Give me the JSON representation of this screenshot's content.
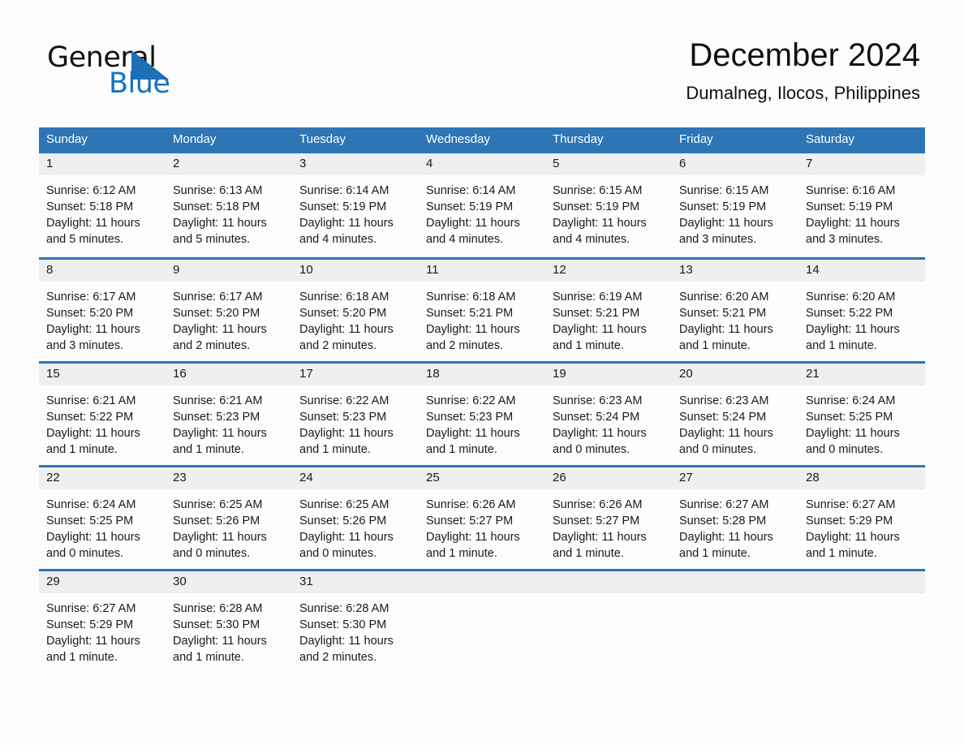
{
  "brand": {
    "name_part1": "General",
    "name_part2": "Blue",
    "logo_icon": "triangle-logo-icon",
    "accent_color": "#1673c4"
  },
  "header": {
    "title": "December 2024",
    "location": "Dumalneg, Ilocos, Philippines"
  },
  "theme": {
    "header_blue": "#2e75b6",
    "row_divider_blue": "#2e75b6",
    "daynum_band_gray": "#efefef",
    "page_background": "#fdfdfd",
    "text_color": "#1a1a1a"
  },
  "weekday_headers": [
    "Sunday",
    "Monday",
    "Tuesday",
    "Wednesday",
    "Thursday",
    "Friday",
    "Saturday"
  ],
  "weeks": [
    [
      {
        "day": "1",
        "sunrise": "Sunrise: 6:12 AM",
        "sunset": "Sunset: 5:18 PM",
        "daylight_line1": "Daylight: 11 hours",
        "daylight_line2": "and 5 minutes."
      },
      {
        "day": "2",
        "sunrise": "Sunrise: 6:13 AM",
        "sunset": "Sunset: 5:18 PM",
        "daylight_line1": "Daylight: 11 hours",
        "daylight_line2": "and 5 minutes."
      },
      {
        "day": "3",
        "sunrise": "Sunrise: 6:14 AM",
        "sunset": "Sunset: 5:19 PM",
        "daylight_line1": "Daylight: 11 hours",
        "daylight_line2": "and 4 minutes."
      },
      {
        "day": "4",
        "sunrise": "Sunrise: 6:14 AM",
        "sunset": "Sunset: 5:19 PM",
        "daylight_line1": "Daylight: 11 hours",
        "daylight_line2": "and 4 minutes."
      },
      {
        "day": "5",
        "sunrise": "Sunrise: 6:15 AM",
        "sunset": "Sunset: 5:19 PM",
        "daylight_line1": "Daylight: 11 hours",
        "daylight_line2": "and 4 minutes."
      },
      {
        "day": "6",
        "sunrise": "Sunrise: 6:15 AM",
        "sunset": "Sunset: 5:19 PM",
        "daylight_line1": "Daylight: 11 hours",
        "daylight_line2": "and 3 minutes."
      },
      {
        "day": "7",
        "sunrise": "Sunrise: 6:16 AM",
        "sunset": "Sunset: 5:19 PM",
        "daylight_line1": "Daylight: 11 hours",
        "daylight_line2": "and 3 minutes."
      }
    ],
    [
      {
        "day": "8",
        "sunrise": "Sunrise: 6:17 AM",
        "sunset": "Sunset: 5:20 PM",
        "daylight_line1": "Daylight: 11 hours",
        "daylight_line2": "and 3 minutes."
      },
      {
        "day": "9",
        "sunrise": "Sunrise: 6:17 AM",
        "sunset": "Sunset: 5:20 PM",
        "daylight_line1": "Daylight: 11 hours",
        "daylight_line2": "and 2 minutes."
      },
      {
        "day": "10",
        "sunrise": "Sunrise: 6:18 AM",
        "sunset": "Sunset: 5:20 PM",
        "daylight_line1": "Daylight: 11 hours",
        "daylight_line2": "and 2 minutes."
      },
      {
        "day": "11",
        "sunrise": "Sunrise: 6:18 AM",
        "sunset": "Sunset: 5:21 PM",
        "daylight_line1": "Daylight: 11 hours",
        "daylight_line2": "and 2 minutes."
      },
      {
        "day": "12",
        "sunrise": "Sunrise: 6:19 AM",
        "sunset": "Sunset: 5:21 PM",
        "daylight_line1": "Daylight: 11 hours",
        "daylight_line2": "and 1 minute."
      },
      {
        "day": "13",
        "sunrise": "Sunrise: 6:20 AM",
        "sunset": "Sunset: 5:21 PM",
        "daylight_line1": "Daylight: 11 hours",
        "daylight_line2": "and 1 minute."
      },
      {
        "day": "14",
        "sunrise": "Sunrise: 6:20 AM",
        "sunset": "Sunset: 5:22 PM",
        "daylight_line1": "Daylight: 11 hours",
        "daylight_line2": "and 1 minute."
      }
    ],
    [
      {
        "day": "15",
        "sunrise": "Sunrise: 6:21 AM",
        "sunset": "Sunset: 5:22 PM",
        "daylight_line1": "Daylight: 11 hours",
        "daylight_line2": "and 1 minute."
      },
      {
        "day": "16",
        "sunrise": "Sunrise: 6:21 AM",
        "sunset": "Sunset: 5:23 PM",
        "daylight_line1": "Daylight: 11 hours",
        "daylight_line2": "and 1 minute."
      },
      {
        "day": "17",
        "sunrise": "Sunrise: 6:22 AM",
        "sunset": "Sunset: 5:23 PM",
        "daylight_line1": "Daylight: 11 hours",
        "daylight_line2": "and 1 minute."
      },
      {
        "day": "18",
        "sunrise": "Sunrise: 6:22 AM",
        "sunset": "Sunset: 5:23 PM",
        "daylight_line1": "Daylight: 11 hours",
        "daylight_line2": "and 1 minute."
      },
      {
        "day": "19",
        "sunrise": "Sunrise: 6:23 AM",
        "sunset": "Sunset: 5:24 PM",
        "daylight_line1": "Daylight: 11 hours",
        "daylight_line2": "and 0 minutes."
      },
      {
        "day": "20",
        "sunrise": "Sunrise: 6:23 AM",
        "sunset": "Sunset: 5:24 PM",
        "daylight_line1": "Daylight: 11 hours",
        "daylight_line2": "and 0 minutes."
      },
      {
        "day": "21",
        "sunrise": "Sunrise: 6:24 AM",
        "sunset": "Sunset: 5:25 PM",
        "daylight_line1": "Daylight: 11 hours",
        "daylight_line2": "and 0 minutes."
      }
    ],
    [
      {
        "day": "22",
        "sunrise": "Sunrise: 6:24 AM",
        "sunset": "Sunset: 5:25 PM",
        "daylight_line1": "Daylight: 11 hours",
        "daylight_line2": "and 0 minutes."
      },
      {
        "day": "23",
        "sunrise": "Sunrise: 6:25 AM",
        "sunset": "Sunset: 5:26 PM",
        "daylight_line1": "Daylight: 11 hours",
        "daylight_line2": "and 0 minutes."
      },
      {
        "day": "24",
        "sunrise": "Sunrise: 6:25 AM",
        "sunset": "Sunset: 5:26 PM",
        "daylight_line1": "Daylight: 11 hours",
        "daylight_line2": "and 0 minutes."
      },
      {
        "day": "25",
        "sunrise": "Sunrise: 6:26 AM",
        "sunset": "Sunset: 5:27 PM",
        "daylight_line1": "Daylight: 11 hours",
        "daylight_line2": "and 1 minute."
      },
      {
        "day": "26",
        "sunrise": "Sunrise: 6:26 AM",
        "sunset": "Sunset: 5:27 PM",
        "daylight_line1": "Daylight: 11 hours",
        "daylight_line2": "and 1 minute."
      },
      {
        "day": "27",
        "sunrise": "Sunrise: 6:27 AM",
        "sunset": "Sunset: 5:28 PM",
        "daylight_line1": "Daylight: 11 hours",
        "daylight_line2": "and 1 minute."
      },
      {
        "day": "28",
        "sunrise": "Sunrise: 6:27 AM",
        "sunset": "Sunset: 5:29 PM",
        "daylight_line1": "Daylight: 11 hours",
        "daylight_line2": "and 1 minute."
      }
    ],
    [
      {
        "day": "29",
        "sunrise": "Sunrise: 6:27 AM",
        "sunset": "Sunset: 5:29 PM",
        "daylight_line1": "Daylight: 11 hours",
        "daylight_line2": "and 1 minute."
      },
      {
        "day": "30",
        "sunrise": "Sunrise: 6:28 AM",
        "sunset": "Sunset: 5:30 PM",
        "daylight_line1": "Daylight: 11 hours",
        "daylight_line2": "and 1 minute."
      },
      {
        "day": "31",
        "sunrise": "Sunrise: 6:28 AM",
        "sunset": "Sunset: 5:30 PM",
        "daylight_line1": "Daylight: 11 hours",
        "daylight_line2": "and 2 minutes."
      },
      {
        "day": "",
        "sunrise": "",
        "sunset": "",
        "daylight_line1": "",
        "daylight_line2": ""
      },
      {
        "day": "",
        "sunrise": "",
        "sunset": "",
        "daylight_line1": "",
        "daylight_line2": ""
      },
      {
        "day": "",
        "sunrise": "",
        "sunset": "",
        "daylight_line1": "",
        "daylight_line2": ""
      },
      {
        "day": "",
        "sunrise": "",
        "sunset": "",
        "daylight_line1": "",
        "daylight_line2": ""
      }
    ]
  ]
}
